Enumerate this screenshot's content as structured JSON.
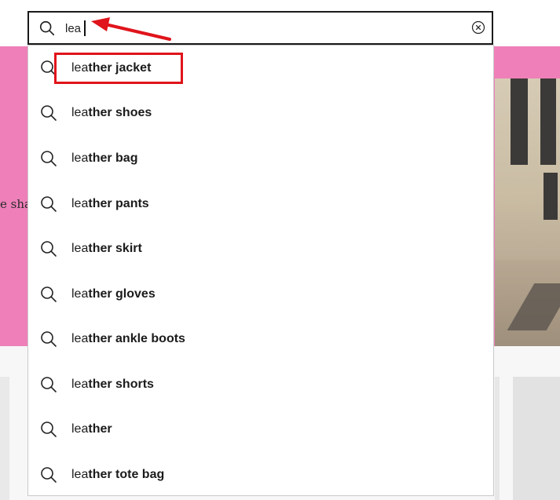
{
  "colors": {
    "banner": "#ee7fb8",
    "annotation": "#e0141b",
    "text": "#1b1b1b"
  },
  "background": {
    "banner_text_fragment": "e sha"
  },
  "search": {
    "icon": "search-icon",
    "value": "lea",
    "clear_icon": "clear-circle-icon"
  },
  "suggestions": [
    {
      "typed": "lea",
      "rest": "ther jacket"
    },
    {
      "typed": "lea",
      "rest": "ther shoes"
    },
    {
      "typed": "lea",
      "rest": "ther bag"
    },
    {
      "typed": "lea",
      "rest": "ther pants"
    },
    {
      "typed": "lea",
      "rest": "ther skirt"
    },
    {
      "typed": "lea",
      "rest": "ther gloves"
    },
    {
      "typed": "lea",
      "rest": "ther ankle boots"
    },
    {
      "typed": "lea",
      "rest": "ther shorts"
    },
    {
      "typed": "lea",
      "rest": "ther"
    },
    {
      "typed": "lea",
      "rest": "ther tote bag"
    }
  ],
  "annotations": {
    "highlight_target": "leather jacket",
    "arrow_target": "search-input"
  }
}
